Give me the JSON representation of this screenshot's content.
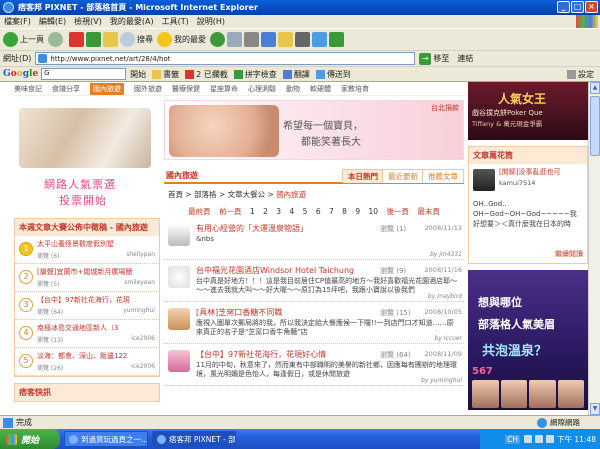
{
  "window": {
    "title": "痞客邦 PIXNET - 部落格首頁 - Microsoft Internet Explorer",
    "controls": {
      "minimize": "_",
      "maximize": "□",
      "close": "×"
    }
  },
  "menu": [
    "檔案(F)",
    "編輯(E)",
    "檢視(V)",
    "我的最愛(A)",
    "工具(T)",
    "說明(H)"
  ],
  "toolbar": {
    "back": "上一頁",
    "search": "搜尋",
    "favorites": "我的最愛"
  },
  "address": {
    "label": "網址(D)",
    "url": "http://www.pixnet.net/art/28/4/hot",
    "go": "移至",
    "links": "連結"
  },
  "googlebar": {
    "logo": [
      "G",
      "o",
      "o",
      "g",
      "l",
      "e"
    ],
    "search_value": "G",
    "go": "開始",
    "bookmarks": "書籤",
    "blocked": "2 已攔截",
    "spellcheck": "拼字檢查",
    "translate": "翻譯",
    "sendto": "傳送到",
    "settings": "設定"
  },
  "sitenav": [
    "美味食記",
    "食譜分享",
    "國內旅遊",
    "國外旅遊",
    "醫療保健",
    "星座算命",
    "心理測驗",
    "動物",
    "軟硬體",
    "家教培育"
  ],
  "left": {
    "logo_line1": "網路人氣票選",
    "logo_line2": "投票開始",
    "panel_title": "本週文章大賽公佈中徵稿 - 國內旅遊",
    "items": [
      {
        "rank": "1",
        "title": "太平山養怪景觀度假別墅",
        "count": "瀏覽 (6)",
        "user": "shellypan"
      },
      {
        "rank": "2",
        "title": "[攝聲]宜蘭市+閱城新月廣場簡",
        "count": "瀏覽 (5)",
        "user": "smileyean"
      },
      {
        "rank": "3",
        "title": "【台中】97新社花海行，花現",
        "count": "瀏覽 (64)",
        "user": "yuminghui"
      },
      {
        "rank": "4",
        "title": "南極冰島交通地區新人（3",
        "count": "瀏覽 (13)",
        "user": "ice2006"
      },
      {
        "rank": "5",
        "title": "淡海：都會、深山、飯邊122",
        "count": "瀏覽 (26)",
        "user": "ice2006"
      }
    ],
    "bottom_title": "痞客快訊"
  },
  "banner": {
    "line1": "希望每一個寶貝，",
    "line2": "都能笑著長大",
    "tag": "台北捐款"
  },
  "tabs": {
    "section": "國內旅遊",
    "items": [
      "本日熱門",
      "最近更新",
      "推薦文章"
    ]
  },
  "breadcrumb": {
    "home": "首頁",
    "sep": " > ",
    "blog": "部落格",
    "board": "文章大餐公",
    "current": "國內旅遊"
  },
  "pager": {
    "first": "最前頁",
    "prev": "前一頁",
    "pages": [
      "1",
      "2",
      "3",
      "4",
      "5",
      "6",
      "7",
      "8",
      "9",
      "10"
    ],
    "next": "後一頁",
    "last": "最末頁"
  },
  "posts": [
    {
      "title": "有用心經營的「大運溫泉物語」",
      "count": "瀏覽 (1)",
      "date": "2008/11/13",
      "body": "&nbs",
      "by": "by jm4331"
    },
    {
      "title": "台中福光花園酒店Windsor Hotel Taichung",
      "count": "瀏覽 (9)",
      "date": "2008/11/16",
      "body": "台中真是好地方！！！這是我目前居住CP值最高的地方～我好喜歡福光花園酒店耶～～～進去我就大叫～～好大喔～～原訂為15坪吧，我跟小寶說以後我們",
      "by": "by maybird"
    },
    {
      "title": "[具林]芝窯口香糖不同職",
      "count": "瀏覽 (15)",
      "date": "2008/10/05",
      "body": "應視入圖單次郵局將的我，所以我決定給大餐應候一下囉!!一到店門口才知道……原來真正的名子是\"芝窯口香牛角麵\"店",
      "by": "by Iccoer"
    },
    {
      "title": "【台中】97新社花海行，花現好心情",
      "count": "瀏覽 (64)",
      "date": "2008/11/09",
      "body": "11月的中旬，秋意來了，然而東有中部職明的美譽的新社鄉，因應每有團辦的地理環境，風光明媚是色怡人，每逢假日，或是休閒旅遊",
      "by": "by yuminghui"
    }
  ],
  "right": {
    "ad_title": "人氣女王",
    "ad_line1": "戲谷撲克餅Poker Que",
    "ad_line2": "Tiffany & 萬元現金爭霸",
    "box_title": "文章萬花筒",
    "box_item_title": "[閒聊]没事亂逛也可",
    "box_item_user": "kamui7514",
    "box_item_body": "OH..God.. OH~God~OH~God~~~~~我好想要＞＜真什麼我在日本的時",
    "box_more": "繼續閱讀",
    "ad2_line1": "想與哪位",
    "ad2_line2": "部落格人氣美眉",
    "ad2_line3": "共泡溫泉？",
    "ad2_num": "567"
  },
  "status": {
    "left": "完成",
    "zone": "網際網路"
  },
  "taskbar": {
    "start": "開始",
    "tasks": [
      "到過貨玩過頁之一...",
      "痞客邦 PIXNET - 部..."
    ],
    "lang": "CH",
    "time": "下午 11:48"
  }
}
